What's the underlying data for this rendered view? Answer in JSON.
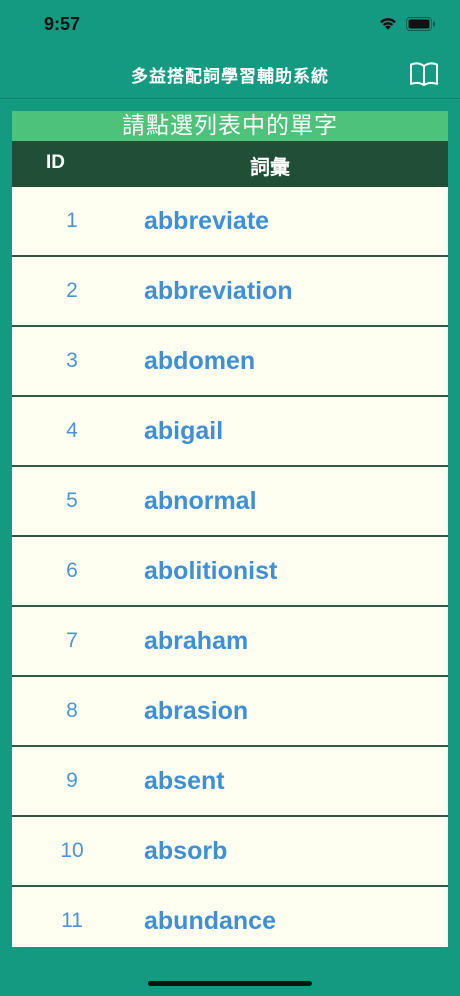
{
  "status_bar": {
    "time": "9:57"
  },
  "nav": {
    "title": "多益搭配詞學習輔助系統"
  },
  "banner": {
    "text": "請點選列表中的單字"
  },
  "table": {
    "columns": {
      "id": "ID",
      "word": "詞彙"
    },
    "rows": [
      {
        "id": "1",
        "word": "abbreviate"
      },
      {
        "id": "2",
        "word": "abbreviation"
      },
      {
        "id": "3",
        "word": "abdomen"
      },
      {
        "id": "4",
        "word": "abigail"
      },
      {
        "id": "5",
        "word": "abnormal"
      },
      {
        "id": "6",
        "word": "abolitionist"
      },
      {
        "id": "7",
        "word": "abraham"
      },
      {
        "id": "8",
        "word": "abrasion"
      },
      {
        "id": "9",
        "word": "absent"
      },
      {
        "id": "10",
        "word": "absorb"
      },
      {
        "id": "11",
        "word": "abundance"
      }
    ]
  },
  "icons": {
    "wifi": "wifi-icon",
    "battery": "battery-icon",
    "book": "book-icon"
  },
  "colors": {
    "background": "#149a80",
    "banner": "#4cc27a",
    "header": "#214e36",
    "row_bg": "#fffff1",
    "link": "#3f8fd6"
  }
}
